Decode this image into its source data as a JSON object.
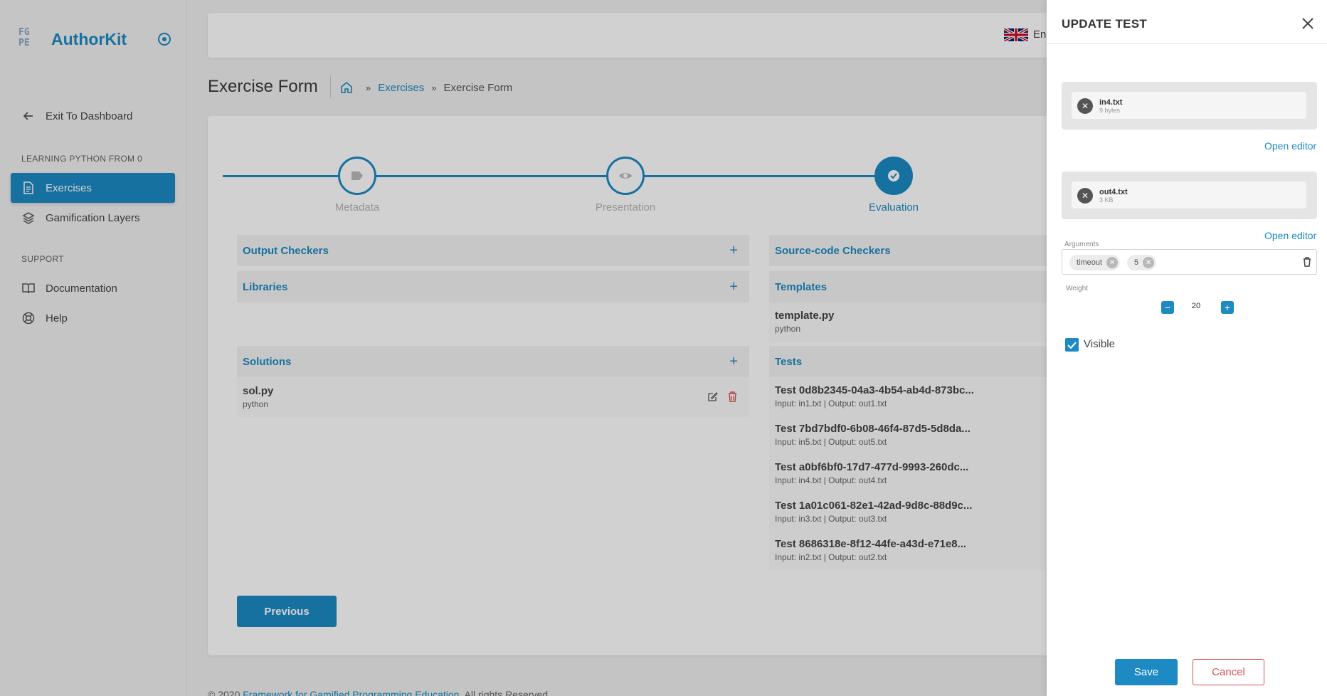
{
  "sidebar": {
    "brand": "AuthorKit",
    "logo_text": [
      "FG",
      "PE"
    ],
    "exit": "Exit To Dashboard",
    "section_course": "LEARNING PYTHON FROM 0",
    "exercises": "Exercises",
    "gamification": "Gamification Layers",
    "section_support": "SUPPORT",
    "documentation": "Documentation",
    "help": "Help"
  },
  "topbar": {
    "language": "En"
  },
  "page": {
    "title": "Exercise Form",
    "breadcrumb": [
      "Exercises",
      "Exercise Form"
    ]
  },
  "stepper": {
    "steps": [
      {
        "label": "Metadata"
      },
      {
        "label": "Presentation"
      },
      {
        "label": "Evaluation"
      }
    ]
  },
  "panels": {
    "output_checkers": "Output Checkers",
    "libraries": "Libraries",
    "solutions": "Solutions",
    "solution_item": {
      "name": "sol.py",
      "lang": "python"
    },
    "source_checkers": "Source-code Checkers",
    "templates": "Templates",
    "template_item": {
      "name": "template.py",
      "lang": "python"
    },
    "tests": "Tests",
    "test_items": [
      {
        "name": "Test 0d8b2345-04a3-4b54-ab4d-873bc...",
        "io": "Input: in1.txt | Output: out1.txt"
      },
      {
        "name": "Test 7bd7bdf0-6b08-46f4-87d5-5d8da...",
        "io": "Input: in5.txt | Output: out5.txt"
      },
      {
        "name": "Test a0bf6bf0-17d7-477d-9993-260dc...",
        "io": "Input: in4.txt | Output: out4.txt"
      },
      {
        "name": "Test 1a01c061-82e1-42ad-9d8c-88d9c...",
        "io": "Input: in3.txt | Output: out3.txt"
      },
      {
        "name": "Test 8686318e-8f12-44fe-a43d-e71e8...",
        "io": "Input: in2.txt | Output: out2.txt"
      }
    ]
  },
  "buttons": {
    "previous": "Previous"
  },
  "footer": {
    "prefix": "© 2020",
    "link": "Framework for Gamified Programming Education",
    "suffix": ". All rights Reserved."
  },
  "drawer": {
    "title": "UPDATE TEST",
    "input_file": {
      "name": "in4.txt",
      "size": "9 bytes"
    },
    "output_file": {
      "name": "out4.txt",
      "size": "3 KB"
    },
    "open_editor": "Open editor",
    "arguments_label": "Arguments",
    "arguments": [
      "timeout",
      "5"
    ],
    "weight_label": "Weight",
    "weight_value": "20",
    "visible_label": "Visible",
    "save": "Save",
    "cancel": "Cancel"
  },
  "colors": {
    "accent": "#1d8ac4",
    "danger": "#d9534f"
  }
}
